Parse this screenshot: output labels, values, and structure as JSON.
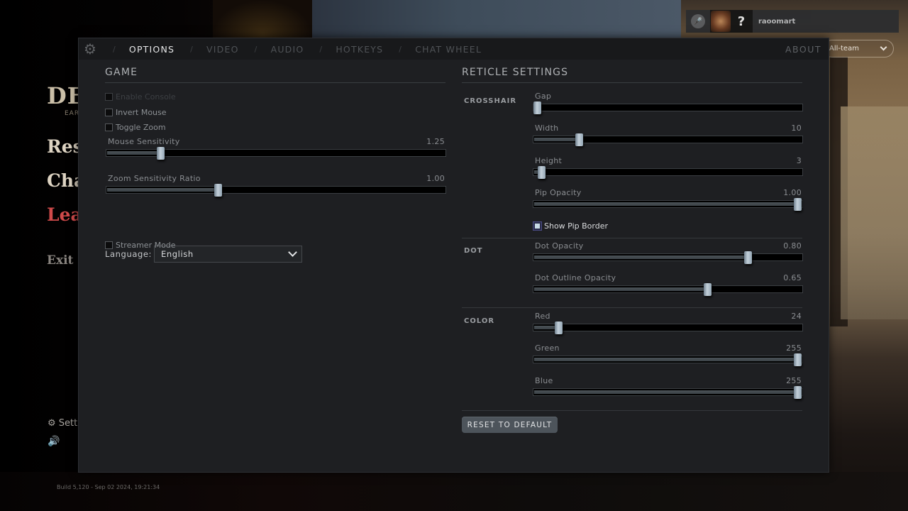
{
  "background_menu": {
    "logo": "DE",
    "logo_sub": "EAR",
    "items": [
      {
        "label": "Res",
        "style": "normal"
      },
      {
        "label": "Cha",
        "style": "normal"
      },
      {
        "label": "Leav",
        "style": "leave"
      },
      {
        "label": "Exit G",
        "style": "exit"
      }
    ],
    "settings_label": "Sett",
    "settings_icon": "gear-icon",
    "sound_icon": "speaker-icon",
    "build_info": "Build 5,120 - Sep 02 2024, 19:21:34"
  },
  "user_bar": {
    "mic_icon": "microphone-icon",
    "party_status": "?",
    "username": "raoomart",
    "chat_channel": "All-team"
  },
  "options_panel": {
    "gear_icon": "gear-icon",
    "tabs": [
      {
        "label": "OPTIONS",
        "active": true
      },
      {
        "label": "VIDEO",
        "active": false
      },
      {
        "label": "AUDIO",
        "active": false
      },
      {
        "label": "HOTKEYS",
        "active": false
      },
      {
        "label": "CHAT WHEEL",
        "active": false
      }
    ],
    "tab_separator": "/",
    "about_label": "ABOUT",
    "game": {
      "title": "GAME",
      "checkboxes": [
        {
          "label": "Enable Console",
          "checked": false,
          "disabled": true
        },
        {
          "label": "Invert Mouse",
          "checked": false,
          "disabled": false
        },
        {
          "label": "Toggle Zoom",
          "checked": false,
          "disabled": false
        }
      ],
      "sliders": [
        {
          "label": "Mouse Sensitivity",
          "value": "1.25",
          "fraction": 0.16
        },
        {
          "label": "Zoom Sensitivity Ratio",
          "value": "1.00",
          "fraction": 0.33
        }
      ],
      "language": {
        "label": "Language:",
        "value": "English"
      },
      "streamer_mode": {
        "label": "Streamer Mode",
        "checked": false
      }
    },
    "reticle": {
      "title": "RETICLE SETTINGS",
      "crosshair": {
        "label": "CROSSHAIR",
        "sliders": [
          {
            "label": "Gap",
            "value": "",
            "fraction": 0.0
          },
          {
            "label": "Width",
            "value": "10",
            "fraction": 0.17
          },
          {
            "label": "Height",
            "value": "3",
            "fraction": 0.03
          },
          {
            "label": "Pip Opacity",
            "value": "1.00",
            "fraction": 1.0
          }
        ],
        "show_pip_border": {
          "label": "Show Pip Border",
          "checked": true
        }
      },
      "dot": {
        "label": "DOT",
        "sliders": [
          {
            "label": "Dot Opacity",
            "value": "0.80",
            "fraction": 0.8
          },
          {
            "label": "Dot Outline Opacity",
            "value": "0.65",
            "fraction": 0.65
          }
        ]
      },
      "color": {
        "label": "COLOR",
        "sliders": [
          {
            "label": "Red",
            "value": "24",
            "fraction": 0.094
          },
          {
            "label": "Green",
            "value": "255",
            "fraction": 1.0
          },
          {
            "label": "Blue",
            "value": "255",
            "fraction": 1.0
          }
        ]
      },
      "reset_label": "RESET TO DEFAULT"
    }
  }
}
